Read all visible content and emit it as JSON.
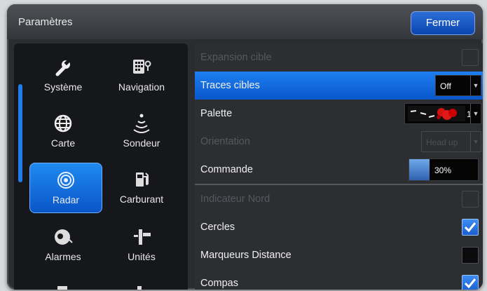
{
  "window": {
    "title": "Paramètres",
    "close_label": "Fermer"
  },
  "sidebar": {
    "items": [
      {
        "label": "Système",
        "icon": "wrench-icon",
        "selected": false
      },
      {
        "label": "Navigation",
        "icon": "navigation-icon",
        "selected": false
      },
      {
        "label": "Carte",
        "icon": "globe-icon",
        "selected": false
      },
      {
        "label": "Sondeur",
        "icon": "sonar-icon",
        "selected": false
      },
      {
        "label": "Radar",
        "icon": "radar-icon",
        "selected": true
      },
      {
        "label": "Carburant",
        "icon": "fuel-pump-icon",
        "selected": false
      },
      {
        "label": "Alarmes",
        "icon": "alarm-bell-icon",
        "selected": false
      },
      {
        "label": "Unités",
        "icon": "units-icon",
        "selected": false
      }
    ]
  },
  "settings": {
    "rows": [
      {
        "label": "Expansion cible",
        "control": "checkbox",
        "checked": false,
        "disabled": true
      },
      {
        "label": "Traces cibles",
        "control": "dropdown",
        "value": "Off",
        "selected": true
      },
      {
        "label": "Palette",
        "control": "palette",
        "value": "1"
      },
      {
        "label": "Orientation",
        "control": "dropdown",
        "value": "Head up",
        "disabled": true
      },
      {
        "label": "Commande",
        "control": "slider",
        "value": "30%",
        "level": 0.3
      },
      {
        "label": "Indicateur Nord",
        "control": "checkbox",
        "checked": false,
        "disabled": true
      },
      {
        "label": "Cercles",
        "control": "checkbox",
        "checked": true
      },
      {
        "label": "Marqueurs Distance",
        "control": "checkbox",
        "checked": false
      },
      {
        "label": "Compas",
        "control": "checkbox",
        "checked": true
      }
    ]
  },
  "colors": {
    "accent": "#1f7ce8",
    "panel": "#2c2e32",
    "sidebar": "#16171a"
  }
}
